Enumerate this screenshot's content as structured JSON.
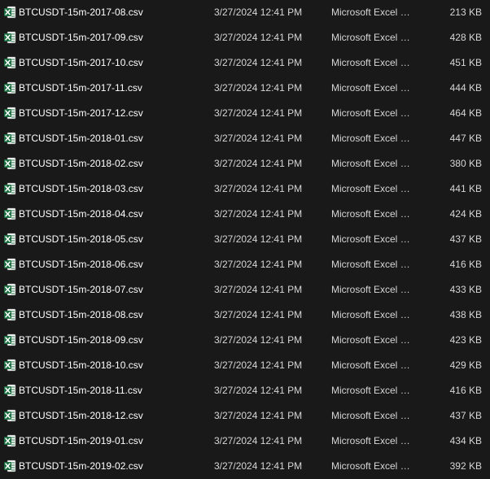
{
  "files": [
    {
      "name": "BTCUSDT-15m-2017-08.csv",
      "modified": "3/27/2024 12:41 PM",
      "type": "Microsoft Excel Comma Separated Values File",
      "size": "213 KB",
      "icon": "excel-csv-icon"
    },
    {
      "name": "BTCUSDT-15m-2017-09.csv",
      "modified": "3/27/2024 12:41 PM",
      "type": "Microsoft Excel Comma Separated Values File",
      "size": "428 KB",
      "icon": "excel-csv-icon"
    },
    {
      "name": "BTCUSDT-15m-2017-10.csv",
      "modified": "3/27/2024 12:41 PM",
      "type": "Microsoft Excel Comma Separated Values File",
      "size": "451 KB",
      "icon": "excel-csv-icon"
    },
    {
      "name": "BTCUSDT-15m-2017-11.csv",
      "modified": "3/27/2024 12:41 PM",
      "type": "Microsoft Excel Comma Separated Values File",
      "size": "444 KB",
      "icon": "excel-csv-icon"
    },
    {
      "name": "BTCUSDT-15m-2017-12.csv",
      "modified": "3/27/2024 12:41 PM",
      "type": "Microsoft Excel Comma Separated Values File",
      "size": "464 KB",
      "icon": "excel-csv-icon"
    },
    {
      "name": "BTCUSDT-15m-2018-01.csv",
      "modified": "3/27/2024 12:41 PM",
      "type": "Microsoft Excel Comma Separated Values File",
      "size": "447 KB",
      "icon": "excel-csv-icon"
    },
    {
      "name": "BTCUSDT-15m-2018-02.csv",
      "modified": "3/27/2024 12:41 PM",
      "type": "Microsoft Excel Comma Separated Values File",
      "size": "380 KB",
      "icon": "excel-csv-icon"
    },
    {
      "name": "BTCUSDT-15m-2018-03.csv",
      "modified": "3/27/2024 12:41 PM",
      "type": "Microsoft Excel Comma Separated Values File",
      "size": "441 KB",
      "icon": "excel-csv-icon"
    },
    {
      "name": "BTCUSDT-15m-2018-04.csv",
      "modified": "3/27/2024 12:41 PM",
      "type": "Microsoft Excel Comma Separated Values File",
      "size": "424 KB",
      "icon": "excel-csv-icon"
    },
    {
      "name": "BTCUSDT-15m-2018-05.csv",
      "modified": "3/27/2024 12:41 PM",
      "type": "Microsoft Excel Comma Separated Values File",
      "size": "437 KB",
      "icon": "excel-csv-icon"
    },
    {
      "name": "BTCUSDT-15m-2018-06.csv",
      "modified": "3/27/2024 12:41 PM",
      "type": "Microsoft Excel Comma Separated Values File",
      "size": "416 KB",
      "icon": "excel-csv-icon"
    },
    {
      "name": "BTCUSDT-15m-2018-07.csv",
      "modified": "3/27/2024 12:41 PM",
      "type": "Microsoft Excel Comma Separated Values File",
      "size": "433 KB",
      "icon": "excel-csv-icon"
    },
    {
      "name": "BTCUSDT-15m-2018-08.csv",
      "modified": "3/27/2024 12:41 PM",
      "type": "Microsoft Excel Comma Separated Values File",
      "size": "438 KB",
      "icon": "excel-csv-icon"
    },
    {
      "name": "BTCUSDT-15m-2018-09.csv",
      "modified": "3/27/2024 12:41 PM",
      "type": "Microsoft Excel Comma Separated Values File",
      "size": "423 KB",
      "icon": "excel-csv-icon"
    },
    {
      "name": "BTCUSDT-15m-2018-10.csv",
      "modified": "3/27/2024 12:41 PM",
      "type": "Microsoft Excel Comma Separated Values File",
      "size": "429 KB",
      "icon": "excel-csv-icon"
    },
    {
      "name": "BTCUSDT-15m-2018-11.csv",
      "modified": "3/27/2024 12:41 PM",
      "type": "Microsoft Excel Comma Separated Values File",
      "size": "416 KB",
      "icon": "excel-csv-icon"
    },
    {
      "name": "BTCUSDT-15m-2018-12.csv",
      "modified": "3/27/2024 12:41 PM",
      "type": "Microsoft Excel Comma Separated Values File",
      "size": "437 KB",
      "icon": "excel-csv-icon"
    },
    {
      "name": "BTCUSDT-15m-2019-01.csv",
      "modified": "3/27/2024 12:41 PM",
      "type": "Microsoft Excel Comma Separated Values File",
      "size": "434 KB",
      "icon": "excel-csv-icon"
    },
    {
      "name": "BTCUSDT-15m-2019-02.csv",
      "modified": "3/27/2024 12:41 PM",
      "type": "Microsoft Excel Comma Separated Values File",
      "size": "392 KB",
      "icon": "excel-csv-icon"
    }
  ],
  "colors": {
    "background": "#191919",
    "text_primary": "#ffffff",
    "text_secondary": "#d6d6d6",
    "excel_green": "#1d6f42"
  }
}
